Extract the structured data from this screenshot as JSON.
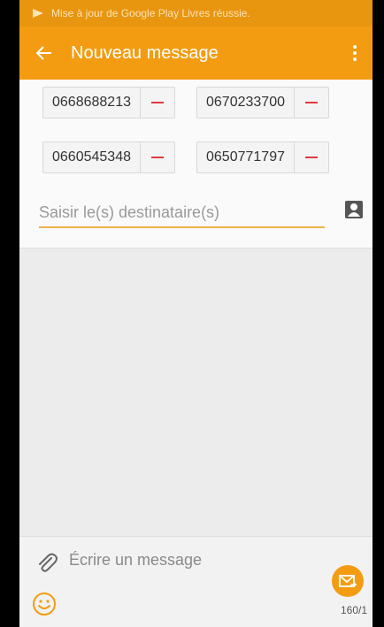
{
  "status_bar": {
    "notification": "Mise à jour de Google Play Livres réussie."
  },
  "app_bar": {
    "title": "Nouveau message"
  },
  "recipients": {
    "chips": [
      "0668688213",
      "0670233700",
      "0660545348",
      "0650771797"
    ],
    "to_field": {
      "placeholder": "Saisir le(s) destinataire(s)",
      "value": ""
    }
  },
  "composer": {
    "placeholder": "Écrire un message",
    "char_counter": "160/1"
  },
  "colors": {
    "accent": "#f39c12",
    "remove": "#e0393e"
  },
  "icons": [
    "play-books-icon",
    "back-arrow-icon",
    "overflow-menu-icon",
    "remove-icon",
    "contact-icon",
    "attach-icon",
    "emoji-icon",
    "send-icon"
  ]
}
